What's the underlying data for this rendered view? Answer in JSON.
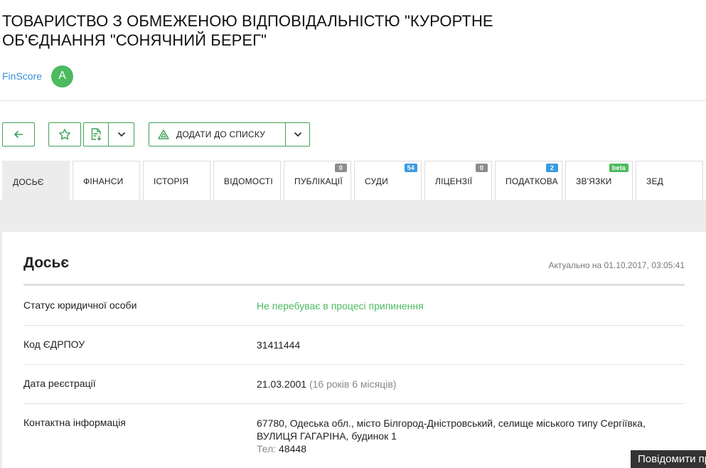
{
  "company": {
    "name": "ТОВАРИСТВО З ОБМЕЖЕНОЮ ВІДПОВІДАЛЬНІСТЮ \"КУРОРТНЕ ОБ'ЄДНАННЯ \"СОНЯЧНИЙ БЕРЕГ\"",
    "finscore_label": "FinScore",
    "finscore_grade": "A"
  },
  "toolbar": {
    "back_icon": "arrow-left-icon",
    "favorite_icon": "star-icon",
    "export_icon": "document-download-icon",
    "add_to_list_icon": "triangle-logo-icon",
    "add_to_list_label": "ДОДАТИ ДО СПИСКУ"
  },
  "tabs": [
    {
      "label": "ДОСЬЄ",
      "active": true
    },
    {
      "label": "ФІНАНСИ"
    },
    {
      "label": "ІСТОРІЯ"
    },
    {
      "label": "ВІДОМОСТІ"
    },
    {
      "label": "ПУБЛІКАЦІЇ",
      "badge": "0",
      "badge_color": "grey"
    },
    {
      "label": "СУДИ",
      "badge": "54",
      "badge_color": "blue"
    },
    {
      "label": "ЛІЦЕНЗІЇ",
      "badge": "0",
      "badge_color": "grey"
    },
    {
      "label": "ПОДАТКОВА",
      "badge": "2",
      "badge_color": "blue"
    },
    {
      "label": "ЗВ'ЯЗКИ",
      "badge": "beta",
      "badge_color": "green"
    },
    {
      "label": "ЗЕД"
    }
  ],
  "dossier": {
    "title": "Досьє",
    "actual": "Актуально на 01.10.2017, 03:05:41",
    "rows": [
      {
        "label": "Статус юридичної особи",
        "value": "Не перебуває в процесі припинення"
      },
      {
        "label": "Код ЄДРПОУ",
        "value": "31411444"
      },
      {
        "label": "Дата реєстрації",
        "value": "21.03.2001",
        "note": "(16 років 6 місяців)"
      },
      {
        "label": "Контактна інформація",
        "value": "67780, Одеська обл., місто Білгород-Дністровський, селище міського типу Сергіївка, ВУЛИЦЯ ГАГАРІНА, будинок 1",
        "phone_label": "Тел:",
        "phone": "48448"
      }
    ]
  },
  "report_button": "Повідомити про помилку",
  "colors": {
    "accent_green": "#4cba5f",
    "link_blue": "#3a8fd6",
    "badge_blue": "#3a9be0",
    "badge_grey": "#8c8c8c"
  }
}
